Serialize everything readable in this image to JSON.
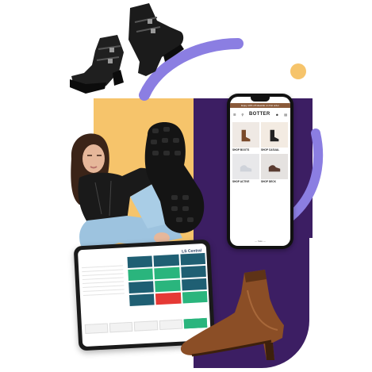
{
  "colors": {
    "yellow": "#f6c46b",
    "purple": "#3c1e63",
    "lavender": "#8b7ee2",
    "tablet_teal": "#1f5f73",
    "tablet_green": "#2ab57d",
    "tablet_red": "#e53935"
  },
  "phone": {
    "banner": "Enjoy 10% off sitewide on first order",
    "brand": "BOTTER",
    "tiles": [
      {
        "label": "SHOP BOOTS"
      },
      {
        "label": "SHOP CASUAL"
      },
      {
        "label": "SHOP ACTIVE"
      },
      {
        "label": "SHOP DECK"
      }
    ],
    "footer": "— Sale —",
    "icons": [
      "menu-icon",
      "search-icon",
      "profile-icon",
      "bag-icon"
    ]
  },
  "tablet": {
    "brand": "LS Central"
  }
}
